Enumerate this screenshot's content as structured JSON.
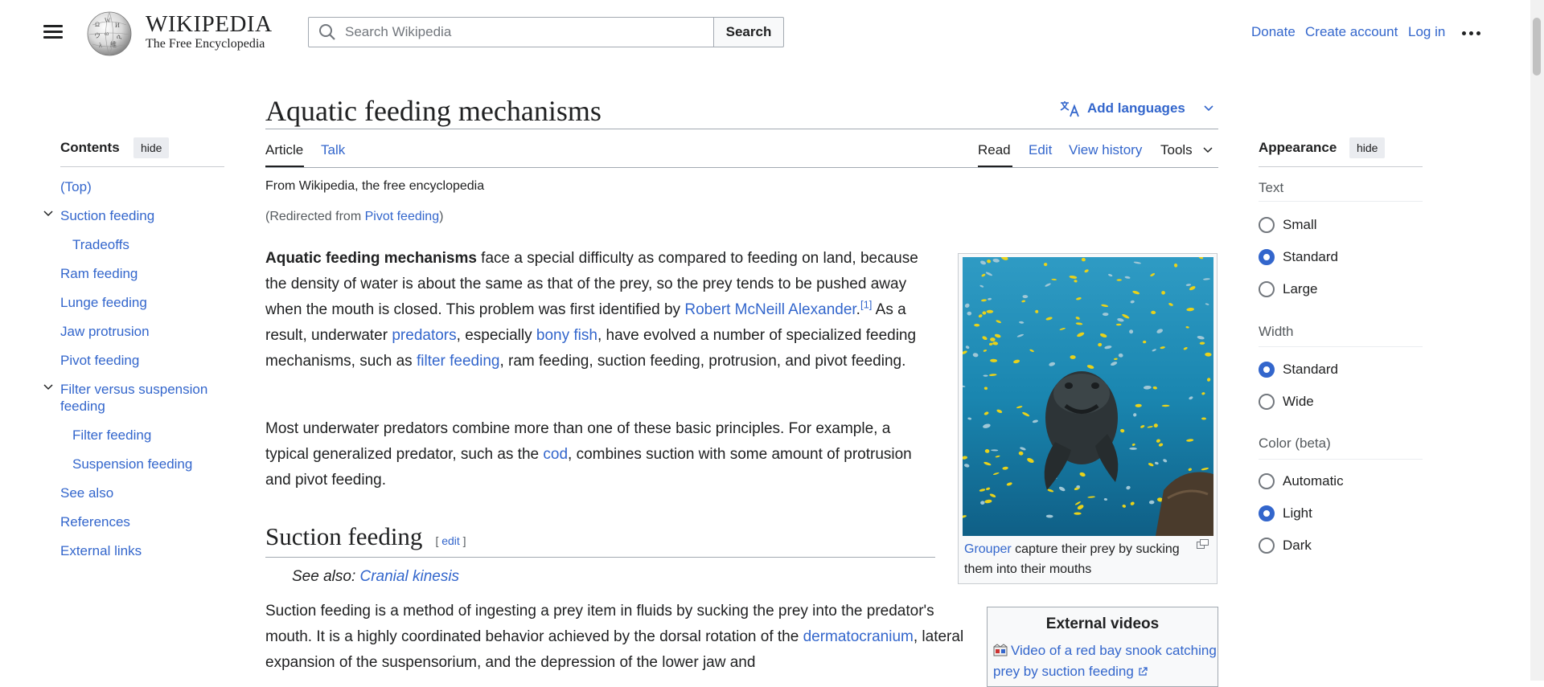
{
  "header": {
    "wordmark": "WIKIPEDIA",
    "tagline": "The Free Encyclopedia",
    "search_placeholder": "Search Wikipedia",
    "search_button": "Search",
    "donate": "Donate",
    "create_account": "Create account",
    "log_in": "Log in"
  },
  "toc": {
    "title": "Contents",
    "hide": "hide",
    "items": [
      "(Top)",
      "Suction feeding",
      "Tradeoffs",
      "Ram feeding",
      "Lunge feeding",
      "Jaw protrusion",
      "Pivot feeding",
      "Filter versus suspension",
      "feeding",
      "Filter feeding",
      "Suspension feeding",
      "See also",
      "References",
      "External links"
    ]
  },
  "article": {
    "title": "Aquatic feeding mechanisms",
    "add_languages": "Add languages",
    "tabs": {
      "article": "Article",
      "talk": "Talk",
      "read": "Read",
      "edit": "Edit",
      "view_history": "View history",
      "tools": "Tools"
    },
    "from": "From Wikipedia, the free encyclopedia",
    "redirect_prefix": "(Redirected from ",
    "redirect_link": "Pivot feeding",
    "redirect_suffix": ")",
    "p1": {
      "bold": "Aquatic feeding mechanisms",
      "t1": " face a special difficulty as compared to feeding on land, because the density of water is about the same as that of the prey, so the prey tends to be pushed away when the mouth is closed. This problem was first identified by ",
      "l1": "Robert McNeill Alexander",
      "t2": ".",
      "ref1": "[1]",
      "t3": " As a result, underwater ",
      "l2": "predators",
      "t4": ", especially ",
      "l3": "bony fish",
      "t5": ", have evolved a number of specialized feeding mechanisms, such as ",
      "l4": "filter feeding",
      "t6": ", ram feeding, suction feeding, protrusion, and pivot feeding."
    },
    "p2": {
      "t1": "Most underwater predators combine more than one of these basic principles. For example, a typical generalized predator, such as the ",
      "l1": "cod",
      "t2": ", combines suction with some amount of protrusion and pivot feeding."
    },
    "section": {
      "title": "Suction feeding",
      "edit_open": "[ ",
      "edit": "edit",
      "edit_close": " ]"
    },
    "see_also_prefix": "See also: ",
    "see_also_link": "Cranial kinesis",
    "p3": {
      "t1": "Suction feeding is a method of ingesting a prey item in fluids by sucking the prey into the predator's mouth. It is a highly coordinated behavior achieved by the dorsal rotation of the ",
      "l1": "dermatocranium",
      "t2": ", lateral expansion of the suspensorium, and the depression of the lower jaw and"
    },
    "figure": {
      "caption_link": "Grouper",
      "caption_text": " capture their prey by sucking them into their mouths"
    },
    "external_videos": {
      "title": "External videos",
      "link": "Video of a red bay snook catching prey by suction feeding"
    }
  },
  "appearance": {
    "title": "Appearance",
    "hide": "hide",
    "text_label": "Text",
    "text_options": [
      "Small",
      "Standard",
      "Large"
    ],
    "text_selected": "Standard",
    "width_label": "Width",
    "width_options": [
      "Standard",
      "Wide"
    ],
    "width_selected": "Standard",
    "color_label": "Color (beta)",
    "color_options": [
      "Automatic",
      "Light",
      "Dark"
    ],
    "color_selected": "Light"
  },
  "colors": {
    "link": "#3366cc",
    "text": "#202122",
    "water": "#1a7fa8",
    "fish": "#e8d21a"
  }
}
